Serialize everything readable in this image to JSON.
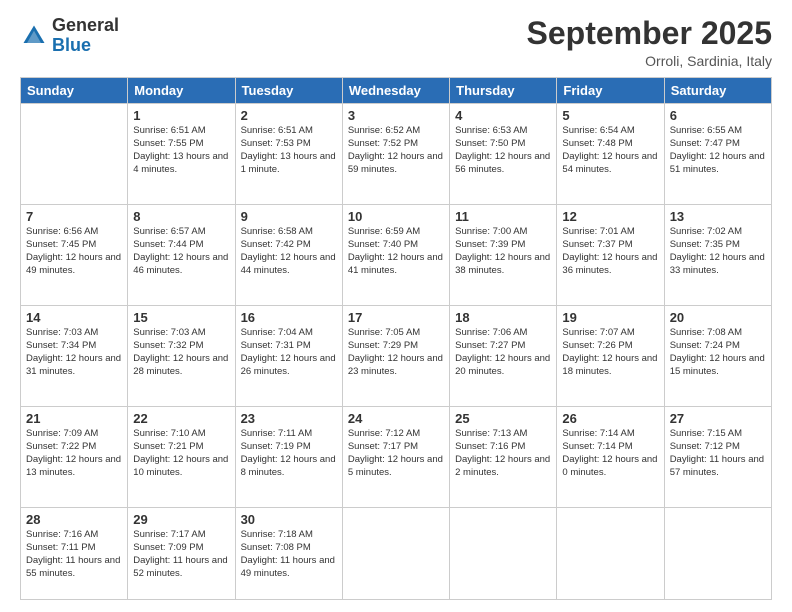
{
  "header": {
    "logo": {
      "general": "General",
      "blue": "Blue"
    },
    "title": "September 2025",
    "location": "Orroli, Sardinia, Italy"
  },
  "calendar": {
    "days_of_week": [
      "Sunday",
      "Monday",
      "Tuesday",
      "Wednesday",
      "Thursday",
      "Friday",
      "Saturday"
    ],
    "weeks": [
      [
        {
          "day": "",
          "sunrise": "",
          "sunset": "",
          "daylight": ""
        },
        {
          "day": "1",
          "sunrise": "Sunrise: 6:51 AM",
          "sunset": "Sunset: 7:55 PM",
          "daylight": "Daylight: 13 hours and 4 minutes."
        },
        {
          "day": "2",
          "sunrise": "Sunrise: 6:51 AM",
          "sunset": "Sunset: 7:53 PM",
          "daylight": "Daylight: 13 hours and 1 minute."
        },
        {
          "day": "3",
          "sunrise": "Sunrise: 6:52 AM",
          "sunset": "Sunset: 7:52 PM",
          "daylight": "Daylight: 12 hours and 59 minutes."
        },
        {
          "day": "4",
          "sunrise": "Sunrise: 6:53 AM",
          "sunset": "Sunset: 7:50 PM",
          "daylight": "Daylight: 12 hours and 56 minutes."
        },
        {
          "day": "5",
          "sunrise": "Sunrise: 6:54 AM",
          "sunset": "Sunset: 7:48 PM",
          "daylight": "Daylight: 12 hours and 54 minutes."
        },
        {
          "day": "6",
          "sunrise": "Sunrise: 6:55 AM",
          "sunset": "Sunset: 7:47 PM",
          "daylight": "Daylight: 12 hours and 51 minutes."
        }
      ],
      [
        {
          "day": "7",
          "sunrise": "Sunrise: 6:56 AM",
          "sunset": "Sunset: 7:45 PM",
          "daylight": "Daylight: 12 hours and 49 minutes."
        },
        {
          "day": "8",
          "sunrise": "Sunrise: 6:57 AM",
          "sunset": "Sunset: 7:44 PM",
          "daylight": "Daylight: 12 hours and 46 minutes."
        },
        {
          "day": "9",
          "sunrise": "Sunrise: 6:58 AM",
          "sunset": "Sunset: 7:42 PM",
          "daylight": "Daylight: 12 hours and 44 minutes."
        },
        {
          "day": "10",
          "sunrise": "Sunrise: 6:59 AM",
          "sunset": "Sunset: 7:40 PM",
          "daylight": "Daylight: 12 hours and 41 minutes."
        },
        {
          "day": "11",
          "sunrise": "Sunrise: 7:00 AM",
          "sunset": "Sunset: 7:39 PM",
          "daylight": "Daylight: 12 hours and 38 minutes."
        },
        {
          "day": "12",
          "sunrise": "Sunrise: 7:01 AM",
          "sunset": "Sunset: 7:37 PM",
          "daylight": "Daylight: 12 hours and 36 minutes."
        },
        {
          "day": "13",
          "sunrise": "Sunrise: 7:02 AM",
          "sunset": "Sunset: 7:35 PM",
          "daylight": "Daylight: 12 hours and 33 minutes."
        }
      ],
      [
        {
          "day": "14",
          "sunrise": "Sunrise: 7:03 AM",
          "sunset": "Sunset: 7:34 PM",
          "daylight": "Daylight: 12 hours and 31 minutes."
        },
        {
          "day": "15",
          "sunrise": "Sunrise: 7:03 AM",
          "sunset": "Sunset: 7:32 PM",
          "daylight": "Daylight: 12 hours and 28 minutes."
        },
        {
          "day": "16",
          "sunrise": "Sunrise: 7:04 AM",
          "sunset": "Sunset: 7:31 PM",
          "daylight": "Daylight: 12 hours and 26 minutes."
        },
        {
          "day": "17",
          "sunrise": "Sunrise: 7:05 AM",
          "sunset": "Sunset: 7:29 PM",
          "daylight": "Daylight: 12 hours and 23 minutes."
        },
        {
          "day": "18",
          "sunrise": "Sunrise: 7:06 AM",
          "sunset": "Sunset: 7:27 PM",
          "daylight": "Daylight: 12 hours and 20 minutes."
        },
        {
          "day": "19",
          "sunrise": "Sunrise: 7:07 AM",
          "sunset": "Sunset: 7:26 PM",
          "daylight": "Daylight: 12 hours and 18 minutes."
        },
        {
          "day": "20",
          "sunrise": "Sunrise: 7:08 AM",
          "sunset": "Sunset: 7:24 PM",
          "daylight": "Daylight: 12 hours and 15 minutes."
        }
      ],
      [
        {
          "day": "21",
          "sunrise": "Sunrise: 7:09 AM",
          "sunset": "Sunset: 7:22 PM",
          "daylight": "Daylight: 12 hours and 13 minutes."
        },
        {
          "day": "22",
          "sunrise": "Sunrise: 7:10 AM",
          "sunset": "Sunset: 7:21 PM",
          "daylight": "Daylight: 12 hours and 10 minutes."
        },
        {
          "day": "23",
          "sunrise": "Sunrise: 7:11 AM",
          "sunset": "Sunset: 7:19 PM",
          "daylight": "Daylight: 12 hours and 8 minutes."
        },
        {
          "day": "24",
          "sunrise": "Sunrise: 7:12 AM",
          "sunset": "Sunset: 7:17 PM",
          "daylight": "Daylight: 12 hours and 5 minutes."
        },
        {
          "day": "25",
          "sunrise": "Sunrise: 7:13 AM",
          "sunset": "Sunset: 7:16 PM",
          "daylight": "Daylight: 12 hours and 2 minutes."
        },
        {
          "day": "26",
          "sunrise": "Sunrise: 7:14 AM",
          "sunset": "Sunset: 7:14 PM",
          "daylight": "Daylight: 12 hours and 0 minutes."
        },
        {
          "day": "27",
          "sunrise": "Sunrise: 7:15 AM",
          "sunset": "Sunset: 7:12 PM",
          "daylight": "Daylight: 11 hours and 57 minutes."
        }
      ],
      [
        {
          "day": "28",
          "sunrise": "Sunrise: 7:16 AM",
          "sunset": "Sunset: 7:11 PM",
          "daylight": "Daylight: 11 hours and 55 minutes."
        },
        {
          "day": "29",
          "sunrise": "Sunrise: 7:17 AM",
          "sunset": "Sunset: 7:09 PM",
          "daylight": "Daylight: 11 hours and 52 minutes."
        },
        {
          "day": "30",
          "sunrise": "Sunrise: 7:18 AM",
          "sunset": "Sunset: 7:08 PM",
          "daylight": "Daylight: 11 hours and 49 minutes."
        },
        {
          "day": "",
          "sunrise": "",
          "sunset": "",
          "daylight": ""
        },
        {
          "day": "",
          "sunrise": "",
          "sunset": "",
          "daylight": ""
        },
        {
          "day": "",
          "sunrise": "",
          "sunset": "",
          "daylight": ""
        },
        {
          "day": "",
          "sunrise": "",
          "sunset": "",
          "daylight": ""
        }
      ]
    ]
  }
}
